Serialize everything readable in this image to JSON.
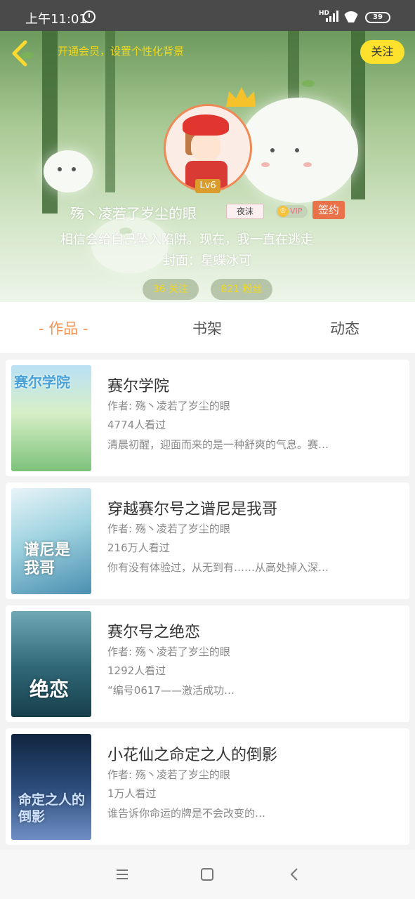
{
  "status_bar": {
    "time": "上午11:01",
    "network": "HD",
    "battery": "39"
  },
  "header": {
    "vip_background_prompt": "开通会员，设置个性化背景",
    "follow_label": "关注",
    "level": "Lv6",
    "username": "殇丶凌若了岁尘的眼",
    "nickname_tag": "夜沫",
    "vip_label": "VIP",
    "signed_label": "签约",
    "bio": "相信会给自己坠入陷阱。现在，我一直在逃走",
    "cover_maker": "封面：星蝶冰可",
    "following": "36 关注",
    "followers": "821 粉丝"
  },
  "tabs": [
    {
      "label": "- 作品 -",
      "active": true
    },
    {
      "label": "书架",
      "active": false
    },
    {
      "label": "动态",
      "active": false
    }
  ],
  "books": [
    {
      "title": "赛尔学院",
      "author": "作者: 殇丶凌若了岁尘的眼",
      "views": "4774人看过",
      "desc": "清晨初醒，迎面而来的是一种舒爽的气息。赛…",
      "cover_text": "赛尔学院"
    },
    {
      "title": "穿越赛尔号之谱尼是我哥",
      "author": "作者: 殇丶凌若了岁尘的眼",
      "views": "216万人看过",
      "desc": "你有没有体验过，从无到有……从高处掉入深…",
      "cover_text": "谱尼是我哥"
    },
    {
      "title": "赛尔号之绝恋",
      "author": "作者: 殇丶凌若了岁尘的眼",
      "views": "1292人看过",
      "desc": "“编号0617——激活成功…",
      "cover_text": "绝恋"
    },
    {
      "title": "小花仙之命定之人的倒影",
      "author": "作者: 殇丶凌若了岁尘的眼",
      "views": "1万人看过",
      "desc": "谁告诉你命运的牌是不会改变的…",
      "cover_text": "命定之人的倒影"
    }
  ],
  "colors": {
    "accent": "#f29354",
    "follow_bg": "#fde12d",
    "sign_bg": "#e9724a",
    "level_bg": "#d99c2d"
  },
  "icons": {
    "back": "chevron-left-icon",
    "alarm": "alarm-icon",
    "menu": "menu-icon",
    "home": "home-icon",
    "nav_back": "back-icon"
  }
}
